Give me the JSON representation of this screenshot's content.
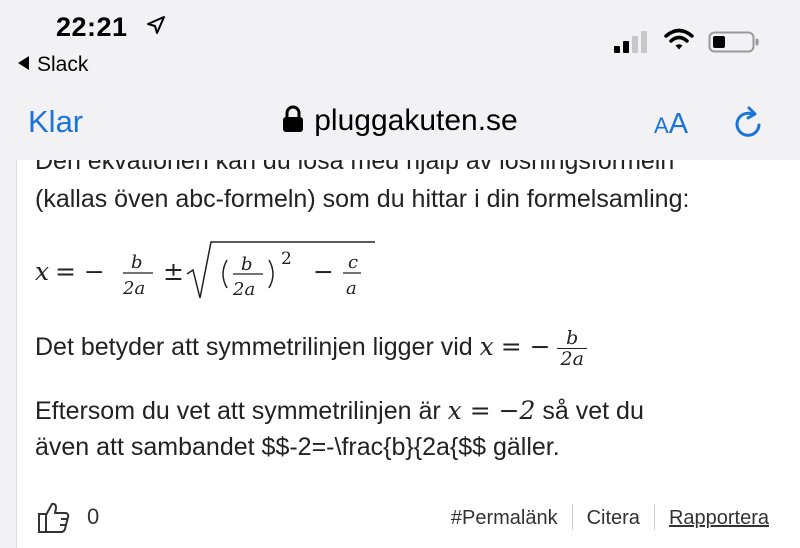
{
  "status_bar": {
    "time": "22:21",
    "back_label": "Slack",
    "icons": [
      "location-arrow-icon",
      "cellular-signal-icon",
      "wifi-icon",
      "battery-icon"
    ]
  },
  "nav": {
    "done": "Klar",
    "url": "pluggakuten.se",
    "text_size_small": "A",
    "text_size_large": "A"
  },
  "post": {
    "cut_line": "Den ekvationen kan du lösa med hjälp av lösningsformeln",
    "line2": "(kallas öven abc-formeln) som du hittar i din formelsamling:",
    "formula": {
      "x": "x",
      "eq": "= −",
      "b": "b",
      "two_a": "2a",
      "pm": "±",
      "exp": "2",
      "minus": "−",
      "c": "c",
      "a": "a"
    },
    "symmetry_text": "Det betyder att symmetrilinjen ligger vid",
    "symmetry_formula": {
      "x": "x",
      "eq": "= −",
      "b": "b",
      "two_a": "2a"
    },
    "eft_line1_a": "Eftersom du vet att symmetrilinjen är",
    "eft_math": "x = −2",
    "eft_line1_b": "så vet du",
    "eft_line2": "även att sambandet $$-2=-\\frac{b}{2a{$$ gäller."
  },
  "footer": {
    "likes": "0",
    "permalink": "#Permalänk",
    "quote": "Citera",
    "report": "Rapportera"
  },
  "colors": {
    "accent": "#1b74d9",
    "bar_background": "#f2f2f4"
  }
}
